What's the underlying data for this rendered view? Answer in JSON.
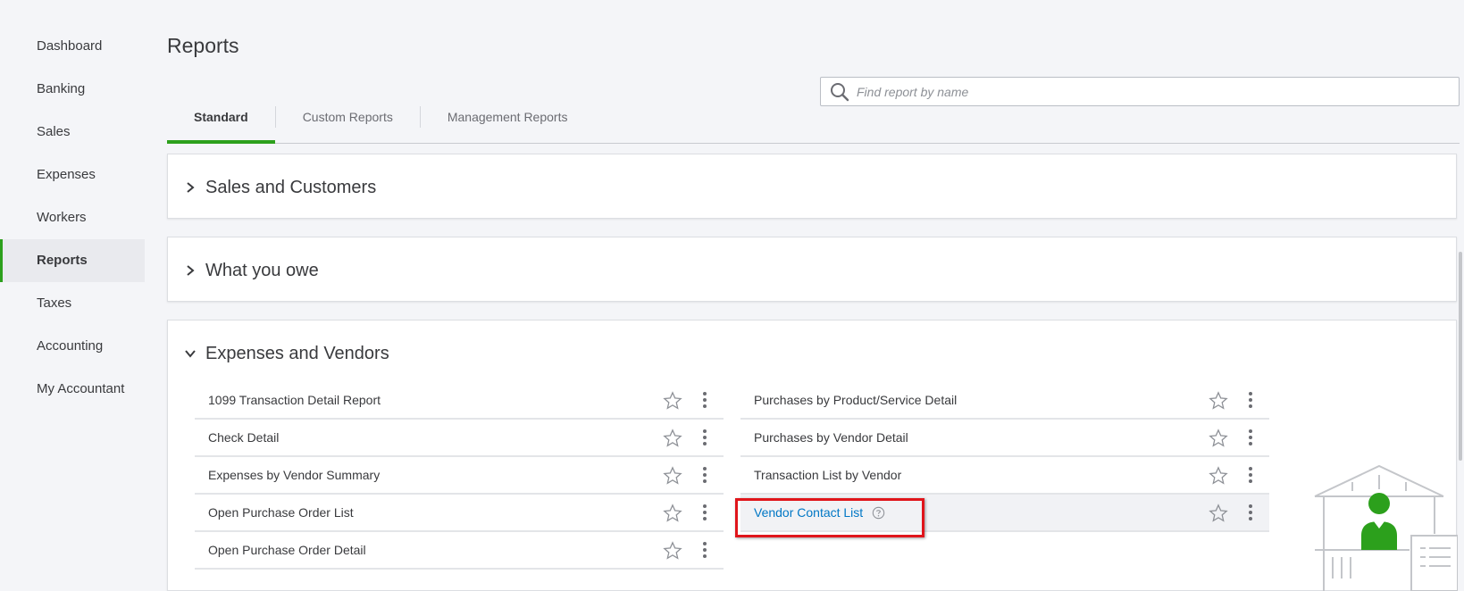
{
  "sidebar": {
    "items": [
      {
        "label": "Dashboard"
      },
      {
        "label": "Banking"
      },
      {
        "label": "Sales"
      },
      {
        "label": "Expenses"
      },
      {
        "label": "Workers"
      },
      {
        "label": "Reports"
      },
      {
        "label": "Taxes"
      },
      {
        "label": "Accounting"
      },
      {
        "label": "My Accountant"
      }
    ],
    "active": "Reports"
  },
  "header": {
    "title": "Reports"
  },
  "search": {
    "placeholder": "Find report by name",
    "value": ""
  },
  "tabs": [
    {
      "label": "Standard"
    },
    {
      "label": "Custom Reports"
    },
    {
      "label": "Management Reports"
    }
  ],
  "sections": [
    {
      "title": "Sales and Customers",
      "expanded": false
    },
    {
      "title": "What you owe",
      "expanded": false
    },
    {
      "title": "Expenses and Vendors",
      "expanded": true,
      "left_reports": [
        {
          "name": "1099 Transaction Detail Report"
        },
        {
          "name": "Check Detail"
        },
        {
          "name": "Expenses by Vendor Summary"
        },
        {
          "name": "Open Purchase Order List"
        },
        {
          "name": "Open Purchase Order Detail"
        }
      ],
      "right_reports": [
        {
          "name": "Purchases by Product/Service Detail"
        },
        {
          "name": "Purchases by Vendor Detail"
        },
        {
          "name": "Transaction List by Vendor"
        },
        {
          "name": "Vendor Contact List"
        }
      ]
    }
  ],
  "icons": {
    "search": "search-icon",
    "chevron_right": "chevron-right-icon",
    "chevron_down": "chevron-down-icon",
    "star": "star-icon",
    "more": "more-vertical-icon",
    "help": "help-circle-icon"
  },
  "colors": {
    "accent_green": "#2ca01c",
    "link_blue": "#0077c5",
    "highlight_red": "#e0151b",
    "text": "#393a3d"
  }
}
